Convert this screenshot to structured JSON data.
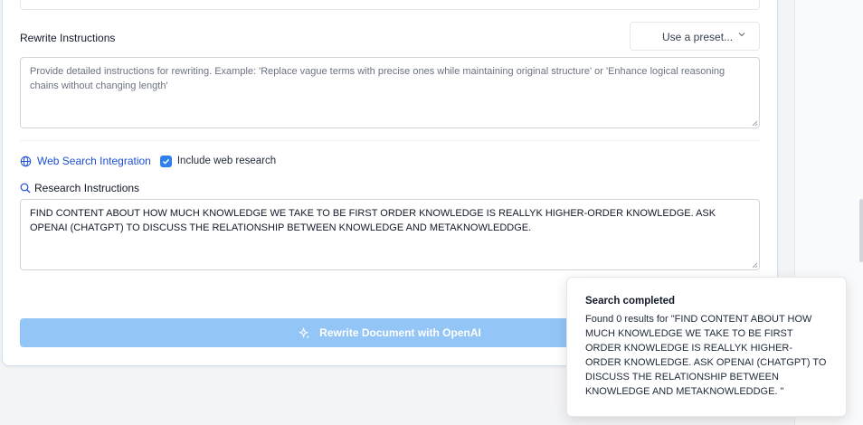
{
  "rewrite": {
    "label": "Rewrite Instructions",
    "preset_label": "Use a preset...",
    "placeholder": "Provide detailed instructions for rewriting. Example: 'Replace vague terms with precise ones while maintaining original structure' or 'Enhance logical reasoning chains without changing length'",
    "value": ""
  },
  "web_search": {
    "label": "Web Search Integration",
    "checkbox_label": "Include web research",
    "checked": true
  },
  "research": {
    "label": "Research Instructions",
    "value": "FIND CONTENT ABOUT HOW MUCH KNOWLEDGE WE TAKE TO BE FIRST ORDER KNOWLEDGE IS REALLYK HIGHER-ORDER KNOWLEDGE. ASK OPENAI (CHATGPT) TO DISCUSS THE RELATIONSHIP BETWEEN KNOWLEDGE AND METAKNOWLEDDGE."
  },
  "action": {
    "rewrite_button": "Rewrite Document with OpenAI"
  },
  "toast": {
    "title": "Search completed",
    "body": "Found 0 results for \"FIND CONTENT ABOUT HOW MUCH KNOWLEDGE WE TAKE TO BE FIRST ORDER KNOWLEDGE IS REALLYK HIGHER-ORDER KNOWLEDGE. ASK OPENAI (CHATGPT) TO DISCUSS THE RELATIONSHIP BETWEEN KNOWLEDGE AND METAKNOWLEDDGE. \""
  },
  "colors": {
    "accent": "#2f80ed",
    "link": "#1d4ed8",
    "button_disabled": "#93c5f6"
  },
  "icons": {
    "web": "globe-icon",
    "research": "search-icon",
    "rewrite": "sparkle-icon",
    "preset": "chevron-down-icon"
  }
}
